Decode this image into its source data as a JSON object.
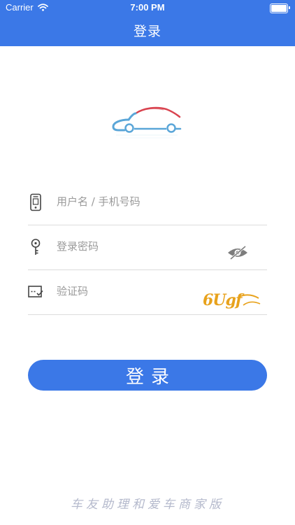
{
  "status_bar": {
    "carrier": "Carrier",
    "time": "7:00 PM",
    "battery_level": 1.0
  },
  "nav": {
    "title": "登录"
  },
  "form": {
    "username": {
      "placeholder": "用户名 / 手机号码",
      "icon": "phone-icon"
    },
    "password": {
      "placeholder": "登录密码",
      "icon": "key-icon",
      "toggle_icon": "eye-hidden-icon"
    },
    "captcha": {
      "placeholder": "验证码",
      "icon": "captcha-icon",
      "code": "6Ugf"
    }
  },
  "login_button": {
    "label": "登录"
  },
  "footer": {
    "text": "车友助理和爱车商家版"
  },
  "colors": {
    "primary": "#3b78e7",
    "logo_red": "#d9434f",
    "logo_blue": "#5aa6d8",
    "captcha_orange": "#e8a21c",
    "footer_text": "#b4b9cc"
  }
}
